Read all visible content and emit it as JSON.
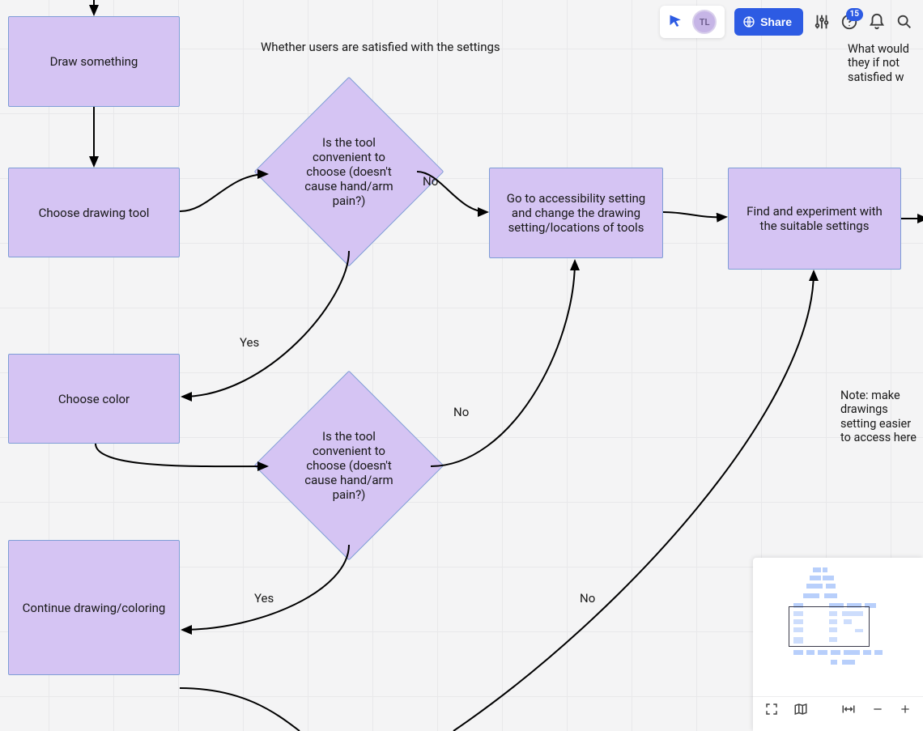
{
  "toolbar": {
    "avatar_initials": "TL",
    "share_label": "Share",
    "help_badge": "15"
  },
  "nodes": {
    "draw_something": "Draw something",
    "choose_tool": "Choose drawing tool",
    "choose_color": "Choose color",
    "continue_drawing": "Continue drawing/coloring",
    "decision_tool_1": "Is the tool convenient to choose (doesn't cause hand/arm pain?)",
    "decision_tool_2": "Is the tool convenient to choose (doesn't cause hand/arm pain?)",
    "goto_accessibility": "Go to accessibility setting and change the drawing setting/locations of tools",
    "find_settings": "Find and experiment with the suitable settings"
  },
  "annotations": {
    "heading_satisfied": "Whether users are satisfied with the settings",
    "heading_not_satisfied": "What would they if not satisfied w",
    "note": "Note: make drawings setting easier to access here"
  },
  "edge_labels": {
    "yes1": "Yes",
    "no1": "No",
    "yes2": "Yes",
    "no2": "No",
    "no3": "No"
  }
}
